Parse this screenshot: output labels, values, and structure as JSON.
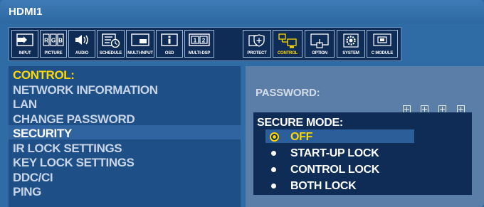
{
  "title": "HDMI1",
  "toolbar": [
    {
      "id": "input",
      "label": "INPUT",
      "icon": "input-icon"
    },
    {
      "id": "picture",
      "label": "PICTURE",
      "icon": "picture-rgb-icon",
      "icon_text": "R G B"
    },
    {
      "id": "audio",
      "label": "AUDIO",
      "icon": "speaker-icon"
    },
    {
      "id": "schedule",
      "label": "SCHEDULE",
      "icon": "schedule-icon"
    },
    {
      "id": "multi-input",
      "label": "MULTI-INPUT",
      "icon": "multi-input-icon"
    },
    {
      "id": "osd",
      "label": "OSD",
      "icon": "info-icon"
    },
    {
      "id": "multi-dsp",
      "label": "MULTI-DSP",
      "icon": "multi-display-icon",
      "icon_text": "1 2"
    },
    {
      "id": "protect",
      "label": "PROTECT",
      "icon": "shield-icon"
    },
    {
      "id": "control",
      "label": "CONTROL",
      "icon": "control-icon",
      "active": true
    },
    {
      "id": "option",
      "label": "OPTION",
      "icon": "option-icon"
    },
    {
      "id": "system",
      "label": "SYSTEM",
      "icon": "gear-icon"
    },
    {
      "id": "c-module",
      "label": "C MODULE",
      "icon": "compute-module-icon"
    }
  ],
  "menu": {
    "header": "CONTROL:",
    "items": [
      "NETWORK INFORMATION",
      "LAN",
      "CHANGE PASSWORD",
      "SECURITY",
      "IR LOCK SETTINGS",
      "KEY LOCK SETTINGS",
      "DDC/CI",
      "PING"
    ],
    "current": "SECURITY"
  },
  "password": {
    "label": "PASSWORD:",
    "digits": 4
  },
  "secure_mode": {
    "label": "SECURE MODE:",
    "options": [
      "OFF",
      "START-UP LOCK",
      "CONTROL LOCK",
      "BOTH LOCK"
    ],
    "selected": "OFF"
  },
  "colors": {
    "background": "#2f6ca6",
    "panel": "#0f2c57",
    "highlight": "#ffd800"
  }
}
